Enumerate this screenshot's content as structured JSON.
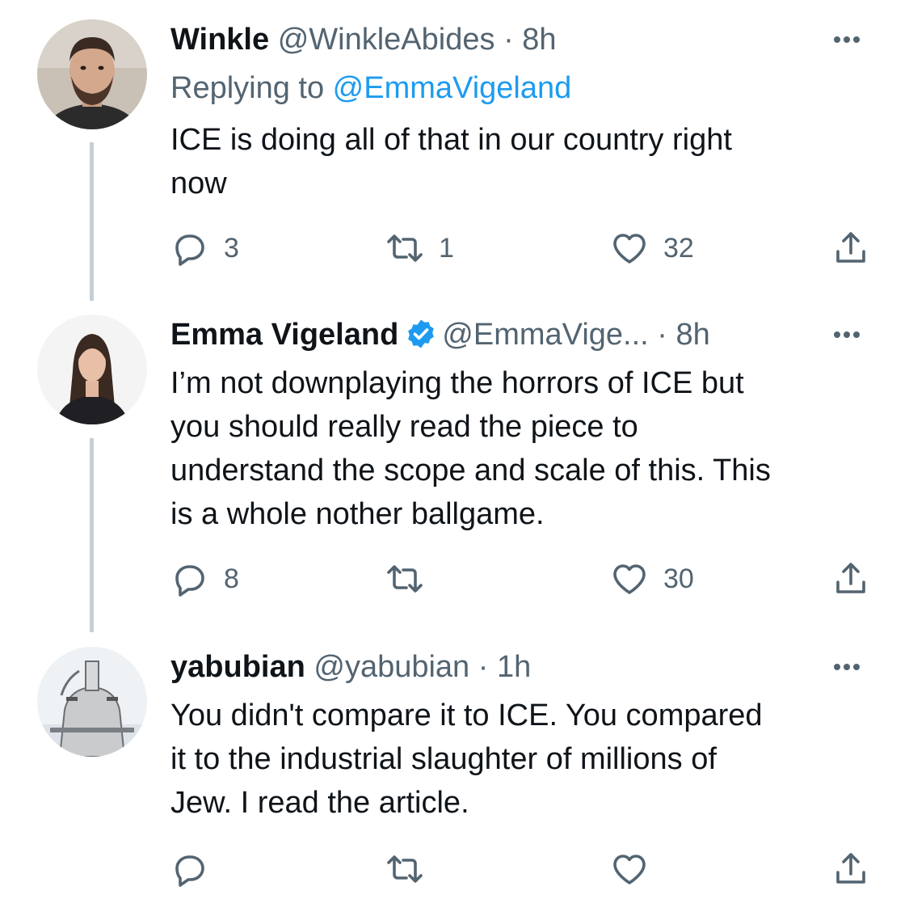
{
  "tweets": [
    {
      "name": "Winkle",
      "handle": "@WinkleAbides",
      "dot": "·",
      "time": "8h",
      "replying_prefix": "Replying to ",
      "replying_mention": "@EmmaVigeland",
      "text_lines": [
        "ICE is doing all of that in our country right",
        "now"
      ],
      "replies": "3",
      "retweets": "1",
      "likes": "32"
    },
    {
      "name": "Emma Vigeland",
      "verified": true,
      "handle": "@EmmaVige...",
      "dot": "·",
      "time": "8h",
      "text_lines": [
        "I’m not downplaying the horrors of ICE but",
        "you should really read the piece to",
        "understand the scope and scale of this. This",
        "is a whole nother ballgame."
      ],
      "replies": "8",
      "retweets": "",
      "likes": "30"
    },
    {
      "name": "yabubian",
      "handle": "@yabubian",
      "dot": "·",
      "time": "1h",
      "text_lines": [
        "You didn't compare it to ICE. You compared",
        "it to the industrial slaughter of millions of",
        "Jew. I read the article."
      ],
      "replies": "",
      "retweets": "",
      "likes": ""
    }
  ],
  "colors": {
    "text": "#0f1419",
    "muted": "#536471",
    "accent": "#1d9bf0",
    "thread_line": "#c4cfd6"
  },
  "icons": {
    "reply": "reply-icon",
    "retweet": "retweet-icon",
    "like": "heart-icon",
    "share": "share-icon",
    "more": "more-icon",
    "verified": "verified-badge-icon"
  }
}
